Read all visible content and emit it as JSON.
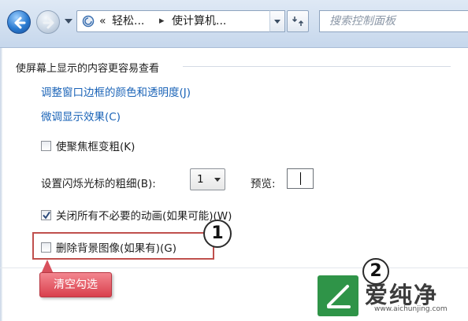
{
  "nav": {
    "breadcrumb_prefix": "«",
    "breadcrumb_1": "轻松...",
    "breadcrumb_sep": "▸",
    "breadcrumb_2": "使计算机...",
    "search_placeholder": "搜索控制面板",
    "icons": [
      "back-arrow-icon",
      "forward-arrow-icon",
      "control-panel-icon",
      "refresh-icon"
    ]
  },
  "content": {
    "heading": "使屏幕上显示的内容更容易查看",
    "link_border": "调整窗口边框的颜色和透明度(J)",
    "link_effects": "微调显示效果(C)",
    "focus_thick_label": "使聚焦框变粗(K)",
    "focus_thick_checked": false,
    "cursor_label": "设置闪烁光标的粗细(B):",
    "cursor_value": "1",
    "preview_label": "预览:",
    "animations_label": "关闭所有不必要的动画(如果可能)(W)",
    "animations_checked": true,
    "background_label": "删除背景图像(如果有)(G)",
    "background_checked": false
  },
  "annotations": {
    "marker_1": "1",
    "marker_2": "2",
    "callout": "清空勾选",
    "highlight_color": "#c0504d",
    "callout_color": "#d9404d"
  },
  "watermark": {
    "name": "爱纯净",
    "url": "www.aichunjing.com",
    "color": "#2f9448"
  }
}
